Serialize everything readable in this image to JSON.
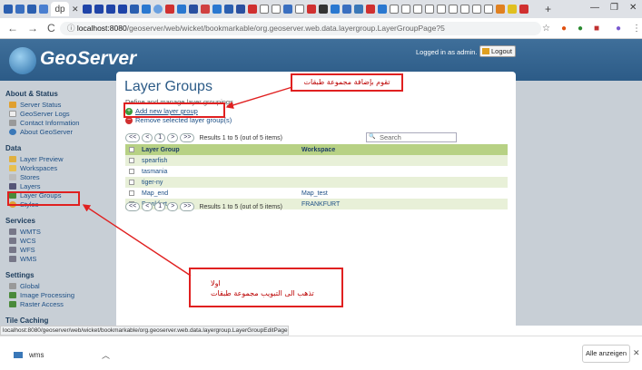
{
  "browser": {
    "url_host": "localhost:8080",
    "url_path": "/geoserver/web/wicket/bookmarkable/org.geoserver.web.data.layergroup.LayerGroupPage?5",
    "tab_label": "dp"
  },
  "header": {
    "logo_text": "GeoServer",
    "logged_in": "Logged in as admin.",
    "logout": "Logout"
  },
  "sidebar": {
    "about_title": "About & Status",
    "about_items": [
      "Server Status",
      "GeoServer Logs",
      "Contact Information",
      "About GeoServer"
    ],
    "data_title": "Data",
    "data_items": [
      "Layer Preview",
      "Workspaces",
      "Stores",
      "Layers",
      "Layer Groups",
      "Styles"
    ],
    "services_title": "Services",
    "services_items": [
      "WMTS",
      "WCS",
      "WFS",
      "WMS"
    ],
    "settings_title": "Settings",
    "settings_items": [
      "Global",
      "Image Processing",
      "Raster Access"
    ],
    "tile_title": "Tile Caching"
  },
  "main": {
    "title": "Layer Groups",
    "subtitle": "Define and manage layer groupings",
    "add_link": "Add new layer group",
    "remove_link": "Remove selected layer group(s)",
    "pager_first": "<<",
    "pager_prev": "<",
    "pager_page": "1",
    "pager_next": ">",
    "pager_last": ">>",
    "results": "Results 1 to 5 (out of 5 items)",
    "search_placeholder": "Search",
    "col_group": "Layer Group",
    "col_workspace": "Workspace",
    "rows": [
      {
        "name": "spearfish",
        "workspace": ""
      },
      {
        "name": "tasmania",
        "workspace": ""
      },
      {
        "name": "tiger-ny",
        "workspace": ""
      },
      {
        "name": "Map_end",
        "workspace": "Map_test"
      },
      {
        "name": "Frankfurt",
        "workspace": "FRANKFURT"
      }
    ]
  },
  "annotations": {
    "top": "تقوم بإضافة مجموعة طبقات",
    "bottom_line1": "اولا",
    "bottom_line2": "تذهب الى التبويب مجموعة طبقات"
  },
  "status_url": "localhost:8080/geoserver/web/wicket/bookmarkable/org.geoserver.web.data.layergroup.LayerGroupEditPage",
  "downloads": {
    "file": "wms",
    "show_all": "Alle anzeigen"
  },
  "colors": {
    "header": "#2c5b87",
    "sidebar": "#c8cfd6",
    "table_header": "#b7d184",
    "annotation": "#e02020"
  }
}
